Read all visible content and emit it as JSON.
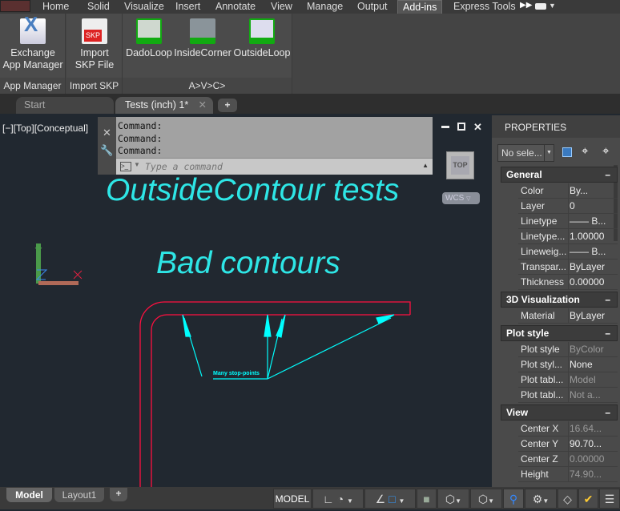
{
  "ribbon": {
    "tabs": [
      "Home",
      "Solid",
      "Visualize",
      "Insert",
      "Annotate",
      "View",
      "Manage",
      "Output",
      "Add-ins",
      "Express Tools"
    ],
    "active_tab": "Add-ins",
    "panels": [
      {
        "label": "App Manager",
        "tools": [
          {
            "label": "Exchange App Manager"
          }
        ]
      },
      {
        "label": "Import SKP",
        "tools": [
          {
            "label": "Import SKP File"
          }
        ]
      },
      {
        "label": "A>V>C>",
        "tools": [
          {
            "label": "DadoLoop"
          },
          {
            "label": "InsideCorner"
          },
          {
            "label": "OutsideLoop"
          }
        ]
      }
    ],
    "icon_badge": "A>V>C>",
    "skp_badge": "SKP"
  },
  "file_tabs": {
    "items": [
      "Start",
      "Tests (inch) 1*"
    ],
    "active": "Tests (inch) 1*"
  },
  "viewport": {
    "label": "[−][Top][Conceptual]",
    "viewcube": "TOP",
    "ucs_menu": "WCS"
  },
  "command": {
    "history": [
      "Command:",
      "Command:",
      "Command:"
    ],
    "placeholder": "Type a command"
  },
  "drawing": {
    "title": "OutsideContour tests",
    "subtitle": "Bad contours",
    "note": "Many stop-points",
    "axis_x": "X",
    "axis_y": "Y",
    "colors": {
      "contour": "#ff1040",
      "annotation": "#00ffff"
    }
  },
  "properties": {
    "title": "PROPERTIES",
    "selection": "No sele...",
    "sections": [
      {
        "name": "General",
        "rows": [
          [
            "Color",
            "By..."
          ],
          [
            "Layer",
            "0"
          ],
          [
            "Linetype",
            "—— B..."
          ],
          [
            "Linetype...",
            "1.00000"
          ],
          [
            "Lineweig...",
            "—— B..."
          ],
          [
            "Transpar...",
            "ByLayer"
          ],
          [
            "Thickness",
            "0.00000"
          ]
        ]
      },
      {
        "name": "3D Visualization",
        "rows": [
          [
            "Material",
            "ByLayer"
          ]
        ]
      },
      {
        "name": "Plot style",
        "rows": [
          [
            "Plot style",
            "ByColor"
          ],
          [
            "Plot styl...",
            "None"
          ],
          [
            "Plot tabl...",
            "Model"
          ],
          [
            "Plot tabl...",
            "Not a..."
          ]
        ]
      },
      {
        "name": "View",
        "rows": [
          [
            "Center X",
            "16.64..."
          ],
          [
            "Center Y",
            "90.70..."
          ],
          [
            "Center Z",
            "0.00000"
          ],
          [
            "Height",
            "74.90..."
          ]
        ]
      }
    ]
  },
  "layout_tabs": {
    "items": [
      "Model",
      "Layout1"
    ],
    "active": "Model"
  },
  "status": {
    "model": "MODEL"
  }
}
